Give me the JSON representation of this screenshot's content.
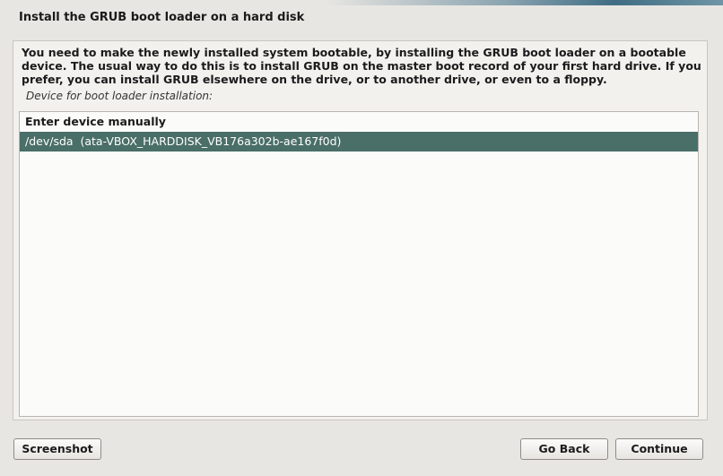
{
  "window": {
    "title": "Install the GRUB boot loader on a hard disk"
  },
  "main": {
    "description": "You need to make the newly installed system bootable, by installing the GRUB boot loader on a bootable device. The usual way to do this is to install GRUB on the master boot record of your first hard drive. If you prefer, you can install GRUB elsewhere on the drive, or to another drive, or even to a floppy.",
    "prompt": "Device for boot loader installation:",
    "devices": [
      {
        "label": "Enter device manually",
        "selected": false
      },
      {
        "label": "/dev/sda  (ata-VBOX_HARDDISK_VB176a302b-ae167f0d)",
        "selected": true
      }
    ]
  },
  "buttons": {
    "screenshot": "Screenshot",
    "go_back": "Go Back",
    "continue": "Continue"
  },
  "colors": {
    "selected_row": "#4a6e68",
    "background": "#e8e6e2"
  }
}
